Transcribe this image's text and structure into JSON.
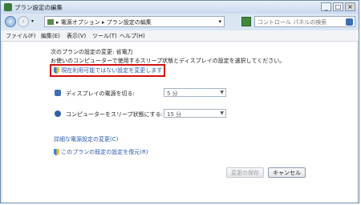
{
  "window": {
    "title": "プラン設定の編集"
  },
  "nav": {
    "back": "‹",
    "forward": "›",
    "address_path": "▸ 電源オプション ▸ プラン設定の編集",
    "search_placeholder": "コントロール パネルの検索"
  },
  "menu": [
    "ファイル(F)",
    "編集(E)",
    "表示(V)",
    "ツール(T)",
    "ヘルプ(H)"
  ],
  "content": {
    "heading": "次のプランの設定の変更: 省電力",
    "description": "お使いのコンピューターで使用するスリープ状態とディスプレイの設定を選択してください。",
    "change_unavailable_link": "現在利用可能ではない設定を変更します",
    "display_label": "ディスプレイの電源を切る:",
    "display_value": "5 分",
    "sleep_label": "コンピューターをスリープ状態にする:",
    "sleep_value": "15 分",
    "advanced_link": "詳細な電源設定の変更(C)",
    "restore_link": "このプランの既定の設定を復元(R)",
    "save_button": "変更の保存",
    "cancel_button": "キャンセル"
  }
}
